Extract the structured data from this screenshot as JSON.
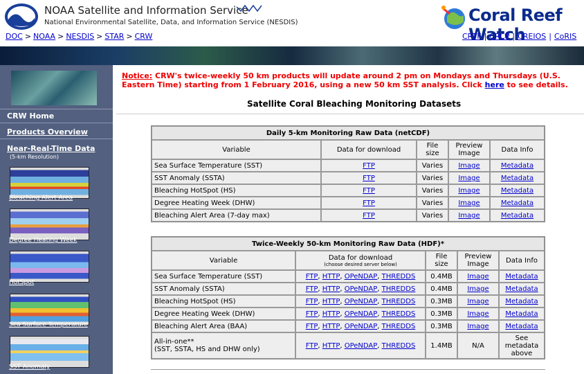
{
  "header": {
    "org_title": "NOAA Satellite and Information Service",
    "org_subtitle": "National Environmental Satellite, Data, and Information Service (NESDIS)",
    "breadcrumbs": [
      "DOC",
      "NOAA",
      "NESDIS",
      "STAR",
      "CRW"
    ],
    "crw_title": "Coral Reef Watch",
    "top_links": [
      "CRTF",
      "CRCP",
      "CREIOS",
      "CoRIS"
    ]
  },
  "sidebar": {
    "home": "CRW Home",
    "products_overview": "Products Overview",
    "nrt_title": "Near-Real-Time Data",
    "nrt_sub": "(5-km Resolution)",
    "thumbs": [
      {
        "caption": "Bleaching Alert Area"
      },
      {
        "caption": "Degree Heating Week"
      },
      {
        "caption": "HotSpot"
      },
      {
        "caption": "Sea Surface Temperature"
      },
      {
        "caption": "SST Anomaly"
      }
    ]
  },
  "notice": {
    "label": "Notice:",
    "text_before_link": " CRW's twice-weekly 50 km products will update around 2 pm on Mondays and Thursdays (U.S. Eastern Time) starting from 1 February 2016, using a new 50 km SST analysis. Click ",
    "link_text": "here",
    "text_after_link": " to see details."
  },
  "page_title": "Satellite Coral Bleaching Monitoring Datasets",
  "table1": {
    "caption": "Daily 5-km Monitoring Raw Data (netCDF)",
    "headers": {
      "variable": "Variable",
      "download": "Data for download",
      "size": "File size",
      "preview": "Preview Image",
      "info": "Data Info"
    },
    "rows": [
      {
        "variable": "Sea Surface Temperature (SST)",
        "download": "FTP",
        "size": "Varies",
        "preview": "Image",
        "info": "Metadata"
      },
      {
        "variable": "SST Anomaly (SSTA)",
        "download": "FTP",
        "size": "Varies",
        "preview": "Image",
        "info": "Metadata"
      },
      {
        "variable": "Bleaching HotSpot (HS)",
        "download": "FTP",
        "size": "Varies",
        "preview": "Image",
        "info": "Metadata"
      },
      {
        "variable": "Degree Heating Week (DHW)",
        "download": "FTP",
        "size": "Varies",
        "preview": "Image",
        "info": "Metadata"
      },
      {
        "variable": "Bleaching Alert Area (7-day max)",
        "download": "FTP",
        "size": "Varies",
        "preview": "Image",
        "info": "Metadata"
      }
    ]
  },
  "table2": {
    "caption": "Twice-Weekly 50-km Monitoring Raw Data (HDF)*",
    "headers": {
      "variable": "Variable",
      "download": "Data for download",
      "download_sub": "(choose desired server below)",
      "size": "File size",
      "preview": "Preview Image",
      "info": "Data Info"
    },
    "links": [
      "FTP",
      "HTTP",
      "OPeNDAP",
      "THREDDS"
    ],
    "rows": [
      {
        "variable": "Sea Surface Temperature (SST)",
        "size": "0.4MB",
        "preview": "Image",
        "info": "Metadata"
      },
      {
        "variable": "SST Anomaly (SSTA)",
        "size": "0.4MB",
        "preview": "Image",
        "info": "Metadata"
      },
      {
        "variable": "Bleaching HotSpot (HS)",
        "size": "0.3MB",
        "preview": "Image",
        "info": "Metadata"
      },
      {
        "variable": "Degree Heating Week (DHW)",
        "size": "0.3MB",
        "preview": "Image",
        "info": "Metadata"
      },
      {
        "variable": "Bleaching Alert Area (BAA)",
        "size": "0.3MB",
        "preview": "Image",
        "info": "Metadata"
      }
    ],
    "allinone": {
      "variable": "All-in-one**",
      "variable_sub": "(SST, SSTA, HS and DHW only)",
      "size": "1.4MB",
      "preview": "N/A",
      "info": "See metadata above"
    }
  }
}
